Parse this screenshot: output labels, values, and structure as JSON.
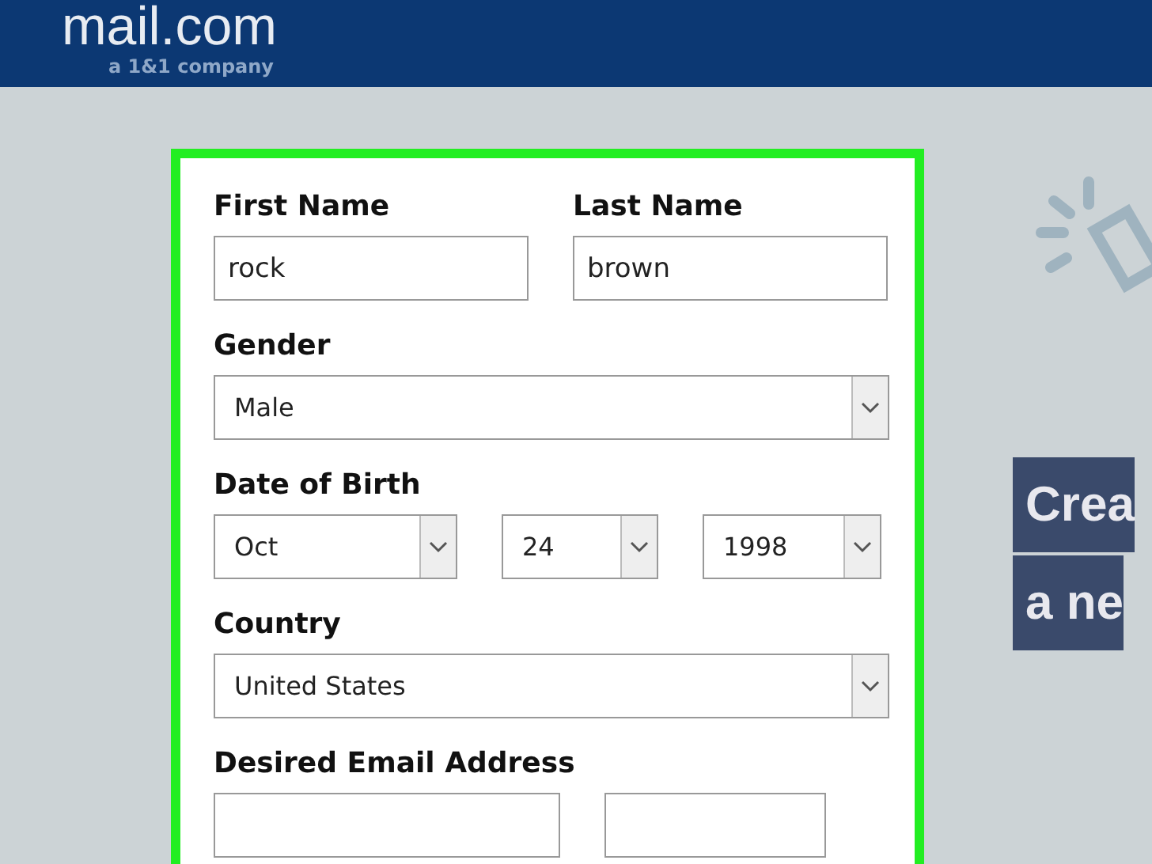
{
  "header": {
    "logo": "mail.com",
    "tagline": "a 1&1 company"
  },
  "form": {
    "fields": [
      {
        "kind": "text_pair",
        "items": [
          {
            "label": "First Name",
            "value": "rock"
          },
          {
            "label": "Last Name",
            "value": "brown"
          }
        ]
      },
      {
        "kind": "select",
        "label": "Gender",
        "value": "Male"
      },
      {
        "kind": "select_row",
        "label": "Date of Birth",
        "values": [
          "Oct",
          "24",
          "1998"
        ]
      },
      {
        "kind": "select",
        "label": "Country",
        "value": "United States"
      },
      {
        "kind": "email",
        "label": "Desired Email Address"
      }
    ]
  },
  "banner": {
    "lines": [
      "Crea",
      "a ne"
    ]
  }
}
